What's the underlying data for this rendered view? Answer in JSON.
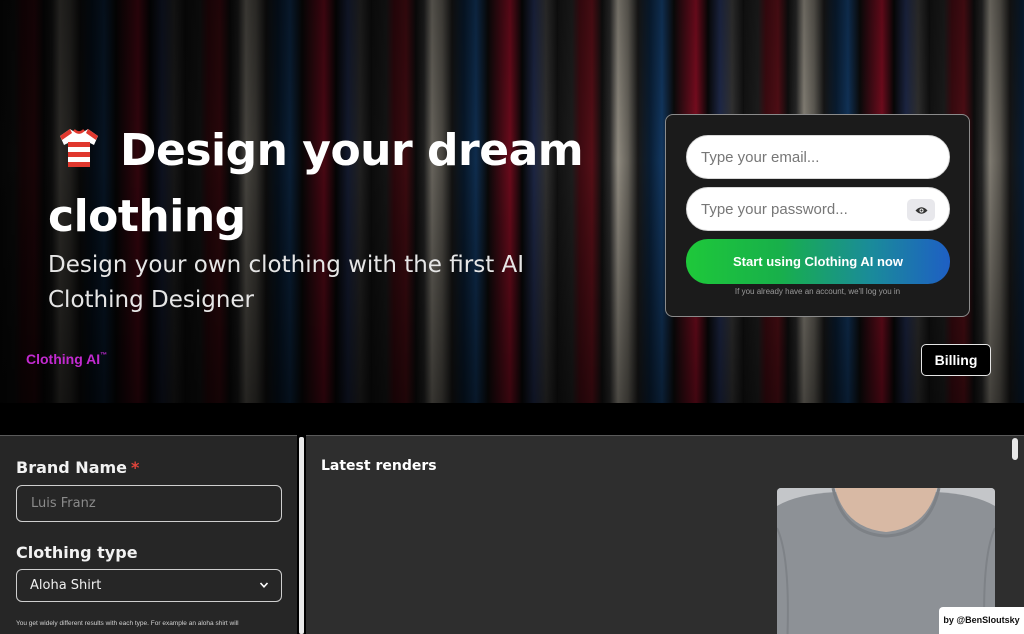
{
  "hero": {
    "title": "Design your dream clothing",
    "subtitle": "Design your own clothing with the first AI Clothing Designer",
    "brand": "Clothing AI",
    "brand_tm": "™",
    "billing_label": "Billing"
  },
  "login": {
    "email_placeholder": "Type your email...",
    "password_placeholder": "Type your password...",
    "start_label": "Start using Clothing AI now",
    "note": "If you already have an account, we'll log you in"
  },
  "form": {
    "brand_label": "Brand Name",
    "required_mark": "*",
    "brand_placeholder": "Luis Franz",
    "type_label": "Clothing type",
    "type_value": "Aloha Shirt",
    "help_text": "You get widely different results with each type. For example an aloha shirt will"
  },
  "renders": {
    "title": "Latest renders"
  },
  "credit": "by @BenSloutsky",
  "colors": {
    "brand_magenta": "#c22ad0",
    "button_gradient_start": "#1ec83a",
    "button_gradient_end": "#1e5fc4",
    "required_red": "#e0443b"
  }
}
